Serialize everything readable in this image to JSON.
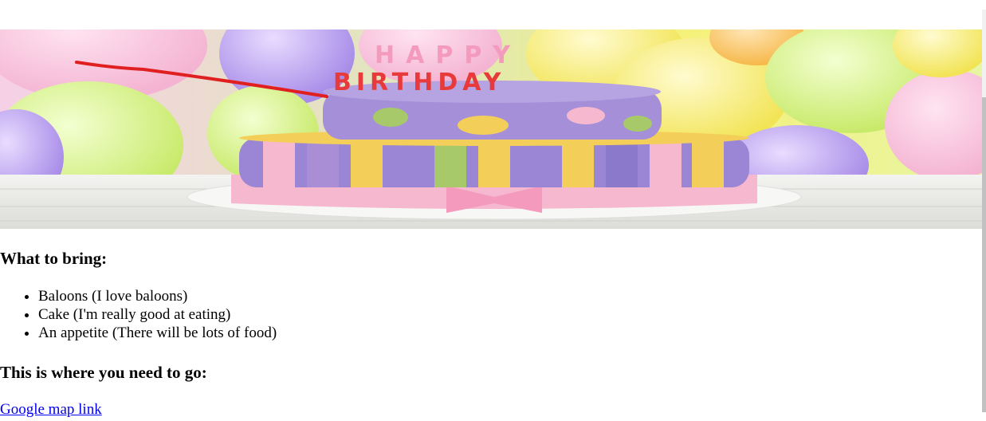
{
  "hero_image": {
    "cake_lettering_line1": "HAPPY",
    "cake_lettering_line2": "BIRTHDAY"
  },
  "bring_section": {
    "heading": "What to bring:",
    "items": [
      "Baloons (I love baloons)",
      "Cake (I'm really good at eating)",
      "An appetite (There will be lots of food)"
    ]
  },
  "go_section": {
    "heading": "This is where you need to go:",
    "link_text": "Google map link"
  },
  "colors": {
    "link": "#0000ee",
    "annotation_line": "#e02020",
    "cake_purple": "#9b86d6",
    "cake_pink": "#f6b8cf",
    "cake_yellow": "#f3cf5a",
    "cake_green": "#a7c96a"
  }
}
